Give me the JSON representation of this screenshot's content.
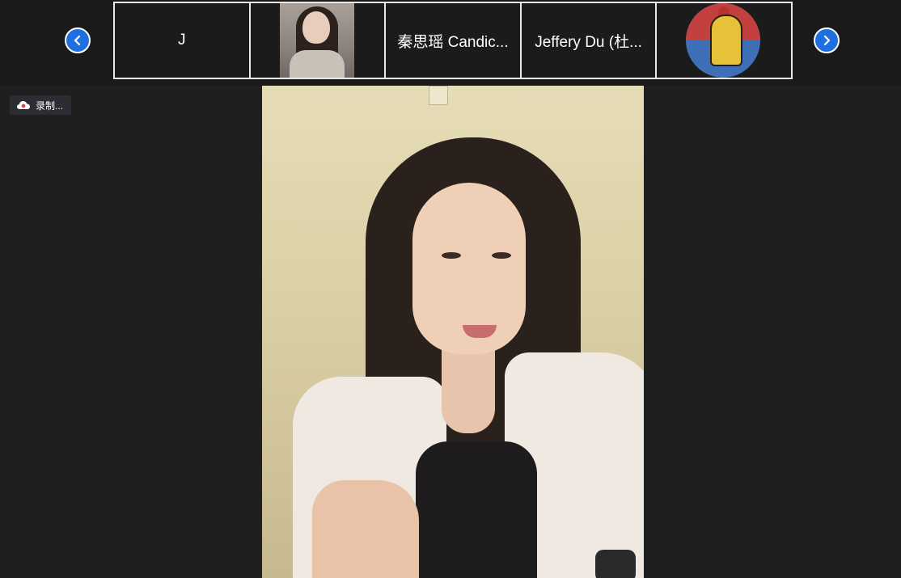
{
  "strip": {
    "prev_label": "Previous page",
    "next_label": "Next page",
    "tiles": [
      {
        "name": "J"
      },
      {
        "name": ""
      },
      {
        "name": "秦思瑶 Candic..."
      },
      {
        "name": "Jeffery Du (杜..."
      },
      {
        "name": ""
      }
    ]
  },
  "recording": {
    "label": "录制..."
  },
  "colors": {
    "accent": "#1e6fe0",
    "background": "#1f1f1f",
    "recording_dot": "#e0474c"
  },
  "icons": {
    "prev": "chevron-left-icon",
    "next": "chevron-right-icon",
    "recording": "cloud-recording-icon"
  }
}
